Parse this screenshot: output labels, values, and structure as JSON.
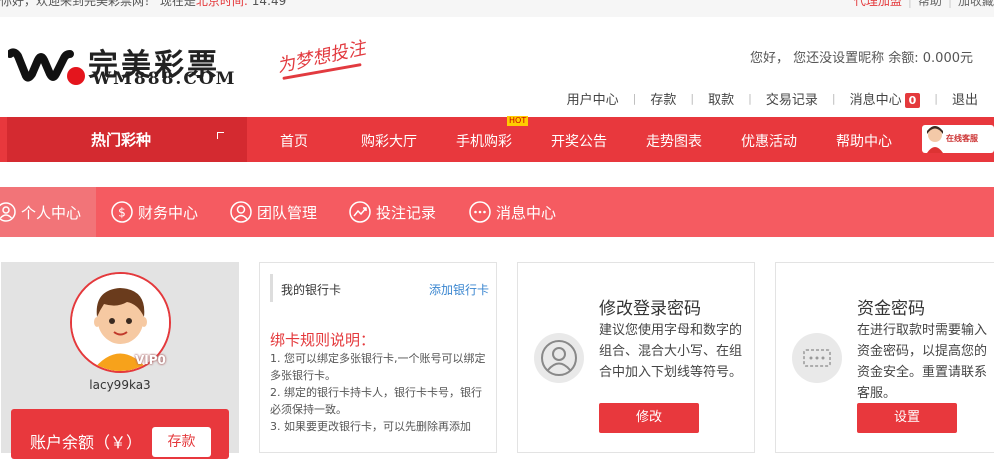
{
  "topbar": {
    "welcome_prefix": "你好，欢迎来到完美彩票网！ 现在是",
    "clock_label": "北京时间:",
    "clock_time": "14:49",
    "agent_link": "代理加盟",
    "help_link": "帮助",
    "favorite_link": "加收藏"
  },
  "brand": {
    "name_cn": "完美彩票",
    "name_en": "WM888.COM",
    "slogan": "为梦想投注"
  },
  "header": {
    "greeting": "您好， 您还没设置昵称  余额:  0.000元"
  },
  "user_nav": [
    {
      "label": "用户中心"
    },
    {
      "label": "存款"
    },
    {
      "label": "取款"
    },
    {
      "label": "交易记录"
    },
    {
      "label": "消息中心",
      "badge": "0"
    },
    {
      "label": "退出"
    }
  ],
  "main_nav": {
    "hot_category": "热门彩种",
    "items": [
      "首页",
      "购彩大厅",
      "手机购彩",
      "开奖公告",
      "走势图表",
      "优惠活动",
      "帮助中心"
    ],
    "hot_tag": "HOT",
    "service_label": "在线客服"
  },
  "sub_nav": {
    "tabs": [
      "个人中心",
      "财务中心",
      "团队管理",
      "投注记录",
      "消息中心"
    ]
  },
  "profile": {
    "vip_badge": "VIP0",
    "username": "lacy99ka3",
    "balance_label": "账户余额（￥）",
    "deposit_button": "存款"
  },
  "bank_card": {
    "title": "我的银行卡",
    "add_link": "添加银行卡",
    "rules_title": "绑卡规则说明：",
    "rules": [
      "1. 您可以绑定多张银行卡,一个账号可以绑定多张银行卡。",
      "2. 绑定的银行卡持卡人，银行卡卡号，银行必须保持一致。",
      "3. 如果要更改银行卡，可以先删除再添加"
    ]
  },
  "login_password": {
    "title": "修改登录密码",
    "desc": "建议您使用字母和数字的组合、混合大小写、在组合中加入下划线等符号。",
    "button": "修改"
  },
  "fund_password": {
    "title": "资金密码",
    "desc_lines": [
      "在进行取款时需要输入",
      "资金密码，以提高您的",
      "资金安全。重置请联系",
      "客服。"
    ],
    "button": "设置"
  },
  "colors": {
    "primary_red": "#e8383d",
    "subnav_red": "#f55b61",
    "link_blue": "#3a86d0"
  }
}
